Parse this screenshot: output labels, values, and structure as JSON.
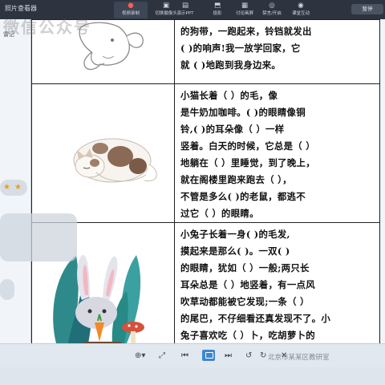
{
  "window": {
    "title": "照片查看器",
    "menu_label": "雷记"
  },
  "toolbar": {
    "buttons": [
      {
        "icon": "record-icon",
        "glyph": "●",
        "label": "视频录制"
      },
      {
        "icon": "camera-off-icon",
        "glyph": "▣",
        "label": "切换摄像头"
      },
      {
        "icon": "slides-icon",
        "glyph": "▤",
        "label": "演示PPT"
      },
      {
        "icon": "screen-share-icon",
        "glyph": "⬒",
        "label": "投影"
      },
      {
        "icon": "board-icon",
        "glyph": "▦",
        "label": "讨论画屏"
      },
      {
        "icon": "mic-off-icon",
        "glyph": "◎",
        "label": "禁言/开启"
      },
      {
        "icon": "live-icon",
        "glyph": "◉",
        "label": "课堂互动"
      }
    ],
    "more_label": "暂停"
  },
  "overlay": {
    "watermark": "微信公众号"
  },
  "worksheet": {
    "rows": [
      {
        "image": "dog-drawing",
        "text": "的狗带，一跑起来，铃铛就发出\n(     )的响声!我一放学回家，它\n就  (     )地跑到我身边来。"
      },
      {
        "image": "cat-drawing",
        "text": "    小猫长着（       ）的毛，像\n是牛奶加咖啡。(   )的眼睛像铜\n铃,(       )的耳朵像（     ）一样\n竖着。白天的时候，它总是（     ）\n地躺在（       ）里睡觉，到了晚上，\n就在阁楼里跑来跑去（       ），\n不管是多么(      )的老鼠，都逃不\n过它（      ）的眼睛。"
      },
      {
        "image": "rabbit-drawing",
        "text": "    小兔子长着一身(      )的毛发,\n摸起来是那么(    )。一双(      )\n的眼睛，犹如（     ）一般;两只长\n耳朵总是（       ）地竖着，有一点风\n吹草动都能被它发现;一条（      ）\n的尾巴，不仔细看还真发现不了。小\n兔子喜欢吃（     ）卜，吃胡萝卜的\n时候，会发出“(      )”的声音，样\n子真是（      ）极了!"
      }
    ]
  },
  "bottom_bar": {
    "caption": "北京市某某区教研室"
  }
}
